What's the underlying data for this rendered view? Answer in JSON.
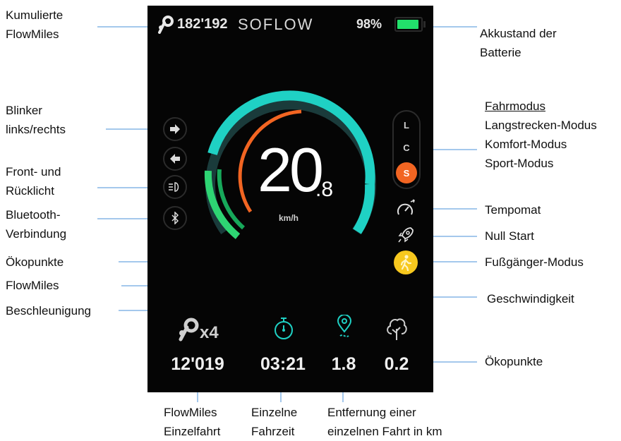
{
  "annotations": {
    "kumulierte": [
      "Kumulierte",
      "FlowMiles"
    ],
    "blinker": [
      "Blinker",
      "links/rechts"
    ],
    "licht": [
      "Front- und",
      "Rücklicht"
    ],
    "bluetooth": [
      "Bluetooth-",
      "Verbindung"
    ],
    "oekopunkte_left": "Ökopunkte",
    "flowmiles_left": "FlowMiles",
    "beschleunigung": "Beschleunigung",
    "akku": [
      "Akkustand der",
      "Batterie"
    ],
    "fahrmodus_title": "Fahrmodus",
    "fahrmodus_items": [
      "Langstrecken-Modus",
      "Komfort-Modus",
      "Sport-Modus"
    ],
    "tempomat": "Tempomat",
    "null_start": "Null Start",
    "fussgaenger": "Fußgänger-Modus",
    "geschwindigkeit": "Geschwindigkeit",
    "oekopunkte_right": "Ökopunkte",
    "flowmiles_einzelfahrt": [
      "FlowMiles",
      "Einzelfahrt"
    ],
    "einzelne_fahrzeit": [
      "Einzelne",
      "Fahrzeit"
    ],
    "entfernung": [
      "Entfernung einer",
      "einzelnen Fahrt in km"
    ]
  },
  "screen": {
    "total_flowmiles": "182'192",
    "brand": "SOFLOW",
    "battery_percent": "98%",
    "battery_level": 0.95,
    "speed_int": "20",
    "speed_dec": ".8",
    "speed_unit": "km/h",
    "modes": [
      "L",
      "C",
      "S"
    ],
    "active_mode": "S",
    "multiplier": "x4",
    "stats": {
      "flowmiles_trip": "12'019",
      "trip_time": "03:21",
      "distance": "1.8",
      "eco_points": "0.2"
    }
  },
  "colors": {
    "teal": "#1fd1c4",
    "orange": "#f26522",
    "green": "#2ed573",
    "battery_green": "#22e06b",
    "pedestrian_yellow": "#f7c81e",
    "line_blue": "#4a90d9"
  },
  "icons": [
    "flowmiles-logo-icon",
    "arrow-right-icon",
    "arrow-left-icon",
    "headlight-icon",
    "bluetooth-icon",
    "cruise-control-icon",
    "rocket-icon",
    "pedestrian-icon",
    "stopwatch-icon",
    "location-pin-icon",
    "tree-icon"
  ]
}
